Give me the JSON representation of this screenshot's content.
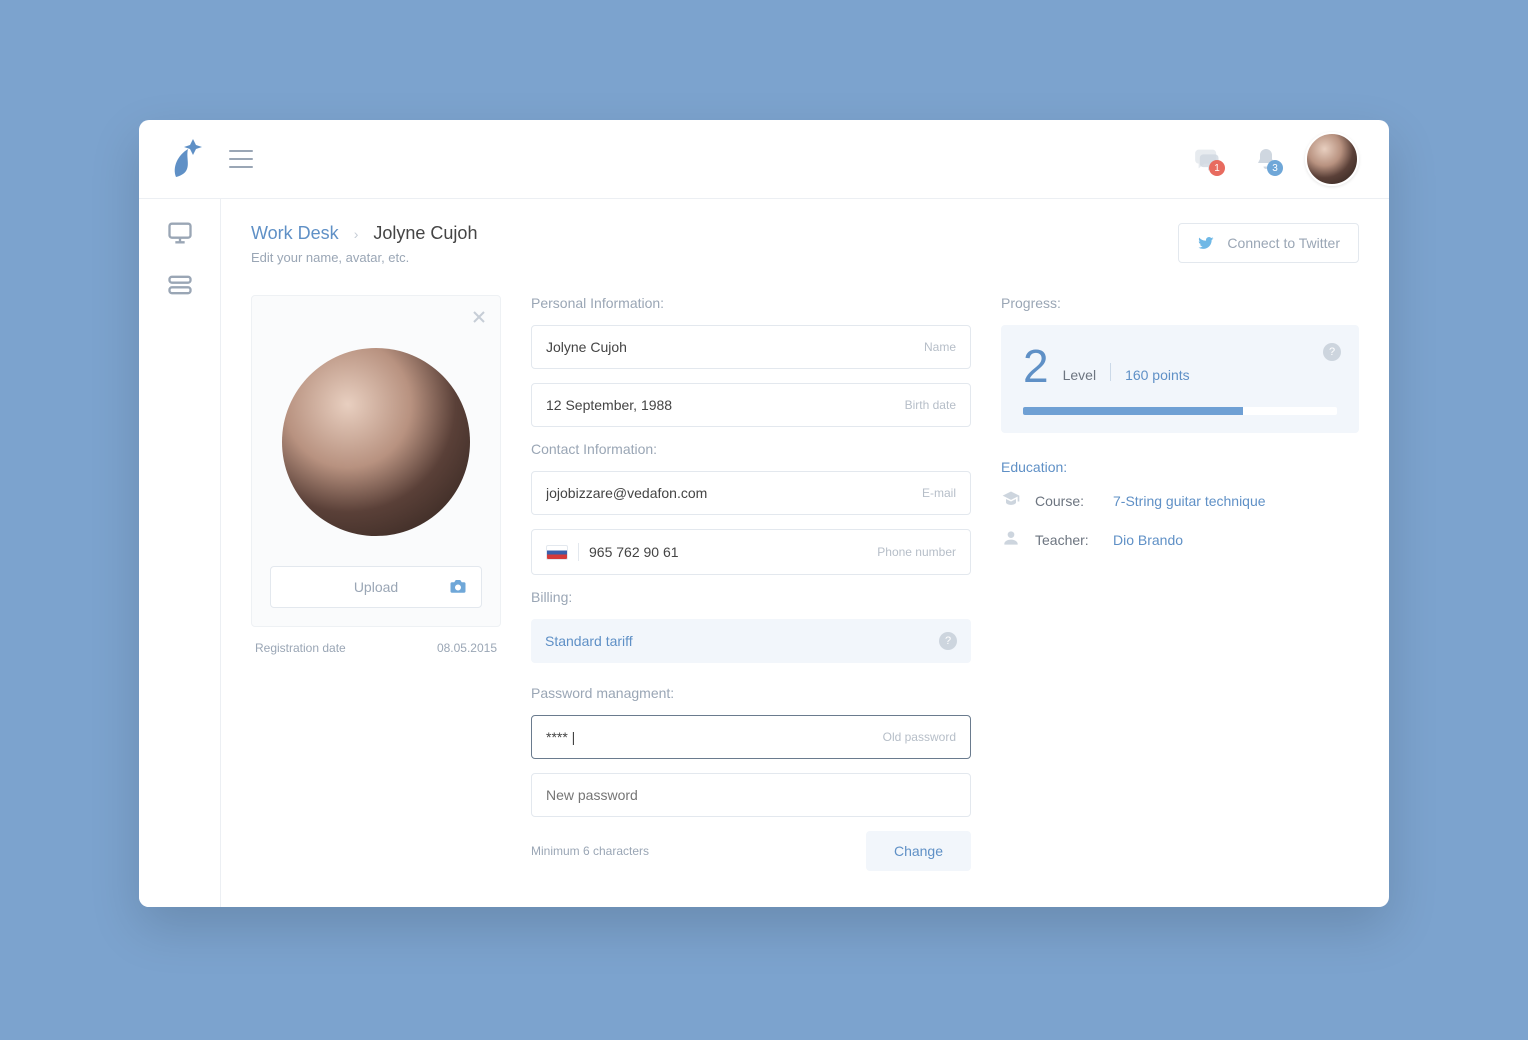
{
  "header": {
    "messages_badge": "1",
    "notifications_badge": "3"
  },
  "breadcrumb": {
    "root": "Work Desk",
    "current": "Jolyne Cujoh"
  },
  "subtitle": "Edit your name, avatar, etc.",
  "twitter_button": "Connect to Twitter",
  "avatar_card": {
    "upload_label": "Upload",
    "reg_label": "Registration date",
    "reg_date": "08.05.2015"
  },
  "personal": {
    "section": "Personal Information:",
    "name_value": "Jolyne Cujoh",
    "name_hint": "Name",
    "birth_value": "12 September, 1988",
    "birth_hint": "Birth date"
  },
  "contact": {
    "section": "Contact Information:",
    "email_value": "jojobizzare@vedafon.com",
    "email_hint": "E-mail",
    "phone_value": "965 762 90 61",
    "phone_hint": "Phone number"
  },
  "billing": {
    "section": "Billing:",
    "tariff": "Standard tariff"
  },
  "password": {
    "section": "Password managment:",
    "old_value": "**** |",
    "old_hint": "Old password",
    "new_placeholder": "New password",
    "min_hint": "Minimum 6 characters",
    "change_label": "Change"
  },
  "progress": {
    "section": "Progress:",
    "level": "2",
    "level_label": "Level",
    "points": "160 points",
    "percent": 70
  },
  "education": {
    "section": "Education:",
    "course_label": "Course:",
    "course_value": "7-String guitar technique",
    "teacher_label": "Teacher:",
    "teacher_value": "Dio Brando"
  }
}
